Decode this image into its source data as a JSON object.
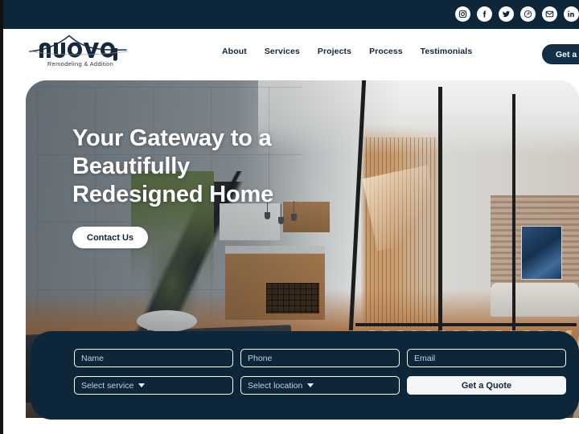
{
  "topbar": {
    "social_icons": [
      {
        "name": "instagram-icon",
        "label": "Instagram"
      },
      {
        "name": "facebook-icon",
        "label": "Facebook"
      },
      {
        "name": "twitter-icon",
        "label": "Twitter"
      },
      {
        "name": "pinterest-icon",
        "label": "Pinterest"
      },
      {
        "name": "gmail-icon",
        "label": "Gmail"
      },
      {
        "name": "linkedin-icon",
        "label": "LinkedIn"
      }
    ]
  },
  "header": {
    "logo_text": "nuova",
    "logo_tagline": "Remodeling & Addition",
    "nav": [
      {
        "label": "About"
      },
      {
        "label": "Services"
      },
      {
        "label": "Projects"
      },
      {
        "label": "Process"
      },
      {
        "label": "Testimonials"
      }
    ],
    "cta_label": "Get a Quote"
  },
  "hero": {
    "title": "Your Gateway to a Beautifully Redesigned Home",
    "button_label": "Contact Us"
  },
  "quote_form": {
    "name_placeholder": "Name",
    "phone_placeholder": "Phone",
    "email_placeholder": "Email",
    "service_label": "Select service",
    "location_label": "Select location",
    "submit_label": "Get a Quote"
  },
  "colors": {
    "navy": "#0d2639",
    "white": "#ffffff",
    "field_text": "#c8d2da",
    "submit_bg": "#f4f5f5"
  }
}
